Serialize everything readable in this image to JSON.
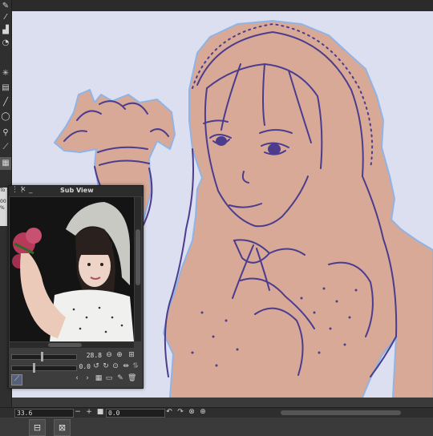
{
  "subview": {
    "title": "Sub View",
    "zoom_value": "28.8",
    "rotate_value": "0.0"
  },
  "status_bar": {
    "zoom_value": "33.6",
    "rotate_value": "0.0"
  },
  "panel_partial": {
    "l1": "To",
    "l2": "00",
    "l3": "%"
  },
  "colors": {
    "canvas_bg": "#dcdff0",
    "skin_fill": "#d8a997",
    "line_art": "#4b3c8e",
    "outline_blue": "#8fb4e6"
  },
  "icons": [
    "pen-icon",
    "brush-icon",
    "airbrush-icon",
    "blend-icon",
    "move-icon",
    "select-icon",
    "line-icon",
    "lasso-icon",
    "wand-icon",
    "eyedropper-icon",
    "fill-icon",
    "zoom-in-icon",
    "zoom-out-icon",
    "fit-icon",
    "rotate-icon",
    "flip-icon"
  ]
}
